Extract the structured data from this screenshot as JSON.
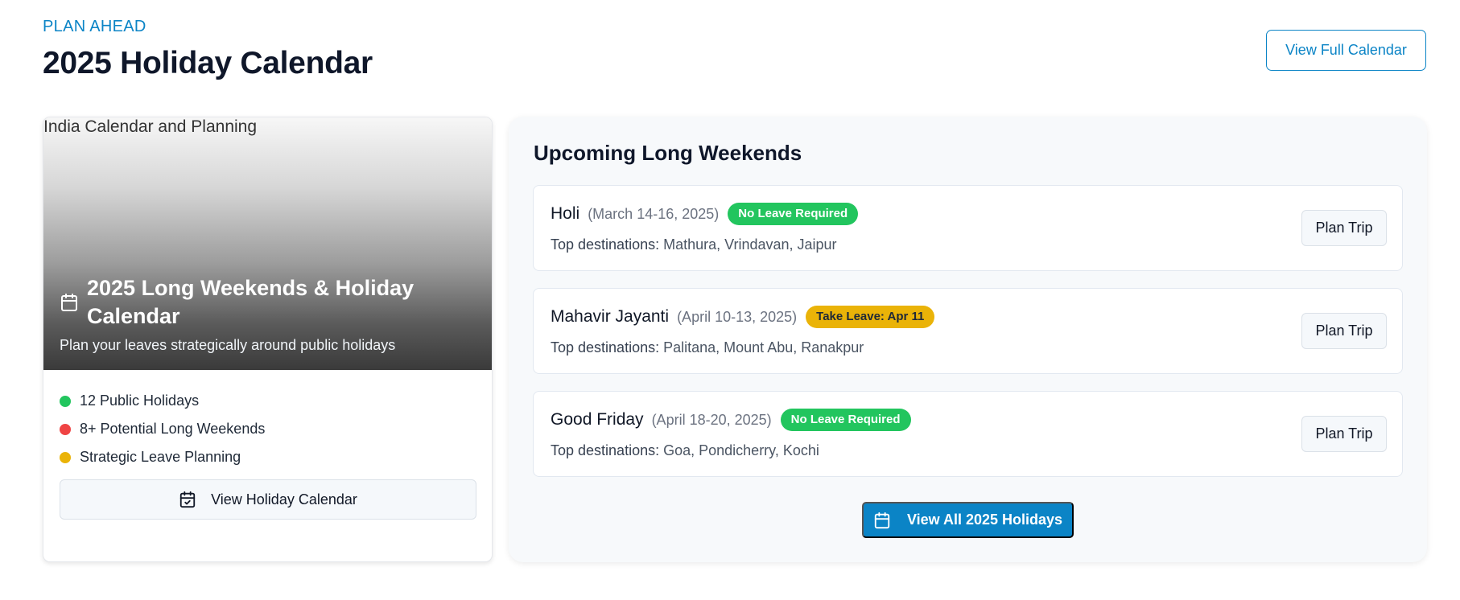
{
  "header": {
    "eyebrow": "PLAN AHEAD",
    "title": "2025 Holiday Calendar",
    "full_calendar_label": "View Full Calendar"
  },
  "left_card": {
    "image_alt": "India Calendar and Planning",
    "title": "2025 Long Weekends & Holiday Calendar",
    "subtitle": "Plan your leaves strategically around public holidays",
    "stats": [
      {
        "label": "12 Public Holidays",
        "color": "#22c55e"
      },
      {
        "label": "8+ Potential Long Weekends",
        "color": "#ef4444"
      },
      {
        "label": "Strategic Leave Planning",
        "color": "#eab308"
      }
    ],
    "button_label": "View Holiday Calendar"
  },
  "right_panel": {
    "title": "Upcoming Long Weekends",
    "destinations_label": "Top destinations:",
    "plan_label": "Plan Trip",
    "weekends": [
      {
        "name": "Holi",
        "dates": "(March 14-16, 2025)",
        "badge": "No Leave Required",
        "badge_color": "#22c55e",
        "destinations": "Mathura, Vrindavan, Jaipur"
      },
      {
        "name": "Mahavir Jayanti",
        "dates": "(April 10-13, 2025)",
        "badge": "Take Leave: Apr 11",
        "badge_color": "#eab308",
        "destinations": "Palitana, Mount Abu, Ranakpur"
      },
      {
        "name": "Good Friday",
        "dates": "(April 18-20, 2025)",
        "badge": "No Leave Required",
        "badge_color": "#22c55e",
        "destinations": "Goa, Pondicherry, Kochi"
      }
    ],
    "all_button_label": "View All 2025 Holidays"
  },
  "colors": {
    "accent": "#0b84c6",
    "green": "#22c55e",
    "red": "#ef4444",
    "amber": "#eab308"
  },
  "icons": {
    "hero": "calendar-icon",
    "holiday_button": "calendar-check-icon",
    "all_button": "calendar-icon"
  }
}
